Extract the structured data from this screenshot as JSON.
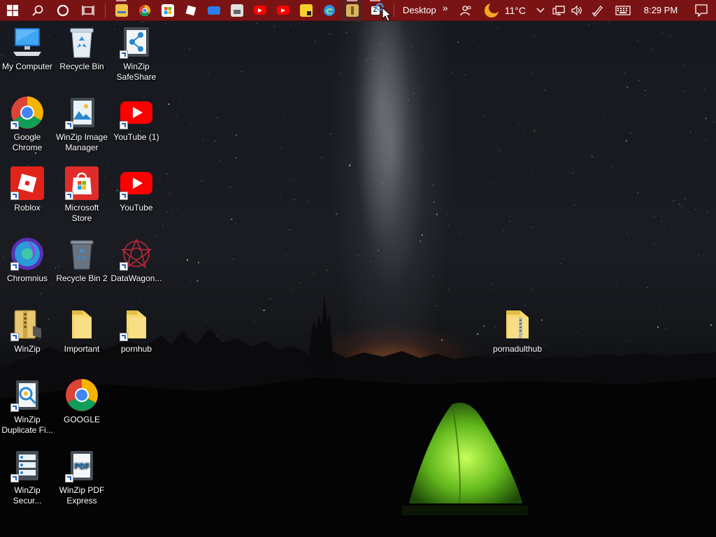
{
  "taskbar": {
    "start_icon": "windows-logo-icon",
    "search_icon": "search-icon",
    "cortana_icon": "cortana-ring-icon",
    "task_view_icon": "task-view-icon",
    "pinned_apps": [
      {
        "name": "file-explorer",
        "color": "#f3c24a",
        "running": true
      },
      {
        "name": "google-chrome",
        "color": "#4285f4",
        "running": false
      },
      {
        "name": "microsoft-store",
        "color": "#ffffff",
        "running": false
      },
      {
        "name": "roblox",
        "color": "#ffffff",
        "running": false
      },
      {
        "name": "remote-desktop",
        "color": "#2b7de9",
        "running": false
      },
      {
        "name": "photo-viewer",
        "color": "#e0e0e0",
        "running": false
      },
      {
        "name": "youtube",
        "color": "#ff0000",
        "running": false
      },
      {
        "name": "youtube-2",
        "color": "#ff0000",
        "running": false
      },
      {
        "name": "sticky-notes",
        "color": "#f6d02f",
        "running": false
      },
      {
        "name": "microsoft-edge",
        "color": "#2f8fdc",
        "running": false
      },
      {
        "name": "winzip",
        "color": "#d8b45c",
        "running": true
      },
      {
        "name": "winzip-app",
        "color": "#ffffff",
        "running": true
      }
    ],
    "desktop_toolbar_label": "Desktop",
    "overflow_chevron": "»",
    "weather_temp": "11°C",
    "clock_time": "8:29 PM"
  },
  "desktop_icons": [
    {
      "label": "My Computer",
      "icon": "my-computer-icon",
      "shortcut": false
    },
    {
      "label": "Recycle Bin",
      "icon": "recycle-bin-icon",
      "shortcut": false
    },
    {
      "label": "WinZip SafeShare",
      "icon": "winzip-safeshare-icon",
      "shortcut": true
    },
    {
      "label": "Google Chrome",
      "icon": "chrome-icon",
      "shortcut": true
    },
    {
      "label": "WinZip Image Manager",
      "icon": "winzip-image-manager-icon",
      "shortcut": true
    },
    {
      "label": "YouTube (1)",
      "icon": "youtube-icon",
      "shortcut": true
    },
    {
      "label": "Roblox",
      "icon": "roblox-icon",
      "shortcut": true
    },
    {
      "label": "Microsoft Store",
      "icon": "microsoft-store-icon",
      "shortcut": true
    },
    {
      "label": "YouTube",
      "icon": "youtube-icon",
      "shortcut": true
    },
    {
      "label": "Chromnius",
      "icon": "chromnius-icon",
      "shortcut": true
    },
    {
      "label": "Recycle Bin 2",
      "icon": "recycle-bin-full-icon",
      "shortcut": false
    },
    {
      "label": "DataWagon...",
      "icon": "datawagon-icon",
      "shortcut": true
    },
    {
      "label": "WinZip",
      "icon": "winzip-icon",
      "shortcut": true
    },
    {
      "label": "Important",
      "icon": "folder-icon",
      "shortcut": false
    },
    {
      "label": "pornhub",
      "icon": "folder-icon",
      "shortcut": true
    },
    {
      "label": "pornadulthub",
      "icon": "folder-icon",
      "shortcut": false
    },
    {
      "label": "WinZip Duplicate Fi...",
      "icon": "winzip-duplicate-finder-icon",
      "shortcut": true
    },
    {
      "label": "GOOGLE",
      "icon": "chrome-icon",
      "shortcut": false
    },
    {
      "label": "WinZip Secur...",
      "icon": "winzip-secure-backup-icon",
      "shortcut": true
    },
    {
      "label": "WinZip PDF Express",
      "icon": "winzip-pdf-express-icon",
      "shortcut": true
    }
  ]
}
